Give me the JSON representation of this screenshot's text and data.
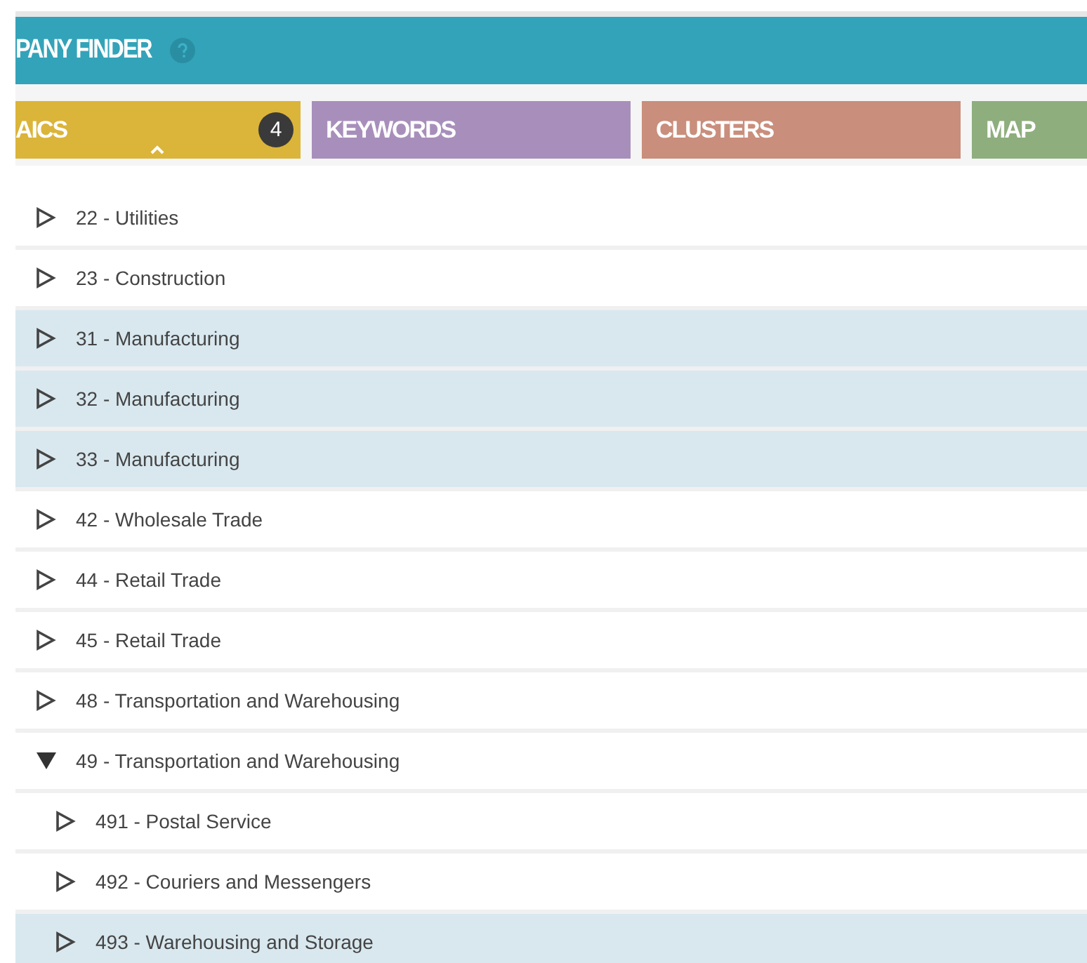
{
  "header": {
    "title": "PANY FINDER"
  },
  "tabs": [
    {
      "label": "AICS",
      "selected": true,
      "color": "#dbb43a",
      "badge": "4"
    },
    {
      "label": "KEYWORDS",
      "selected": false,
      "color": "#a88fbb"
    },
    {
      "label": "CLUSTERS",
      "selected": false,
      "color": "#c98e7c"
    },
    {
      "label": "MAP",
      "selected": false,
      "color": "#8fae7e"
    }
  ],
  "tree": [
    {
      "label": "22 - Utilities",
      "expanded": false,
      "selected": false
    },
    {
      "label": "23 - Construction",
      "expanded": false,
      "selected": false
    },
    {
      "label": "31 - Manufacturing",
      "expanded": false,
      "selected": true
    },
    {
      "label": "32 - Manufacturing",
      "expanded": false,
      "selected": true
    },
    {
      "label": "33 - Manufacturing",
      "expanded": false,
      "selected": true
    },
    {
      "label": "42 - Wholesale Trade",
      "expanded": false,
      "selected": false
    },
    {
      "label": "44 - Retail Trade",
      "expanded": false,
      "selected": false
    },
    {
      "label": "45 - Retail Trade",
      "expanded": false,
      "selected": false
    },
    {
      "label": "48 - Transportation and Warehousing",
      "expanded": false,
      "selected": false
    },
    {
      "label": "49 - Transportation and Warehousing",
      "expanded": true,
      "selected": false,
      "children": [
        {
          "label": "491 - Postal Service",
          "expanded": false,
          "selected": false
        },
        {
          "label": "492 - Couriers and Messengers",
          "expanded": false,
          "selected": false
        },
        {
          "label": "493 - Warehousing and Storage",
          "expanded": false,
          "selected": true
        }
      ]
    }
  ]
}
